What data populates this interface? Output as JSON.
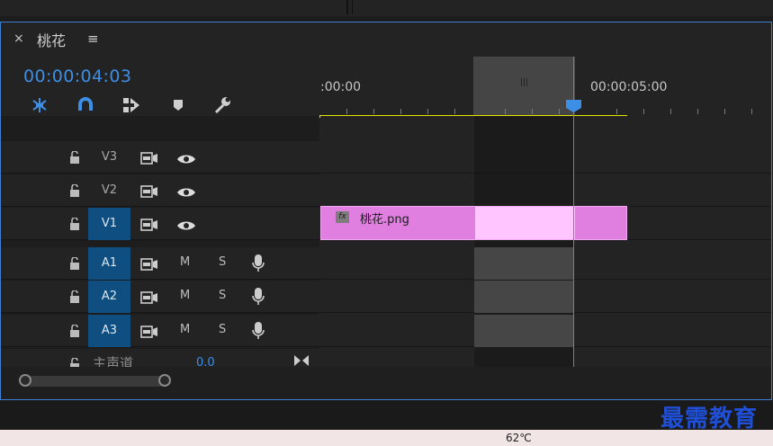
{
  "sequence": {
    "close_symbol": "×",
    "title": "桃花",
    "menu_symbol": "≡"
  },
  "timecode": "00:00:04:03",
  "toolbar": [
    {
      "name": "insert-snap-icon"
    },
    {
      "name": "magnet-snap-icon"
    },
    {
      "name": "linked-selection-icon"
    },
    {
      "name": "add-marker-icon"
    },
    {
      "name": "settings-wrench-icon"
    }
  ],
  "ruler": {
    "label_start": ":00:00",
    "label_end": "00:00:05:00",
    "grip": "|||"
  },
  "tracks": {
    "video": [
      {
        "name": "V3",
        "active": false
      },
      {
        "name": "V2",
        "active": false
      },
      {
        "name": "V1",
        "active": true
      }
    ],
    "audio": [
      {
        "name": "A1",
        "active": true,
        "m": "M",
        "s": "S"
      },
      {
        "name": "A2",
        "active": true,
        "m": "M",
        "s": "S"
      },
      {
        "name": "A3",
        "active": true,
        "m": "M",
        "s": "S"
      }
    ],
    "master": {
      "label": "主声道",
      "value": "0.0"
    }
  },
  "clip": {
    "fx": "fx",
    "name": "桃花.png"
  },
  "colors": {
    "accent": "#3d8fe6",
    "clip": "#e07fe0",
    "clip_selected": "#ffc5ff",
    "work_area": "#e6e600",
    "track_on": "#0e4e80"
  },
  "watermark": "最需教育",
  "status": {
    "temperature": "62℃"
  }
}
